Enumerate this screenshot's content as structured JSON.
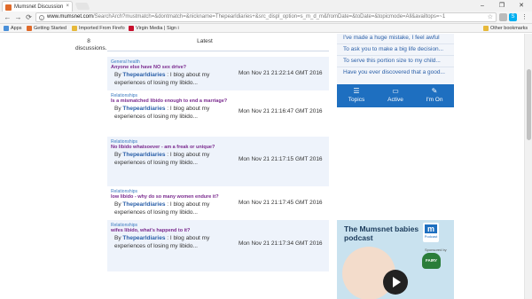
{
  "browser": {
    "tab_title": "Mumsnet Discussion",
    "tab_close": "×",
    "url_host": "www.mumsnet.com",
    "url_rest": "/SearchArch?mustmatch=&dontmatch=&nickname=Thepearldiaries+&src_displ_option=s_m_d_m&fromDate=&toDate=&topicmode=All&availtops=~1",
    "window_controls": [
      "–",
      "❐",
      "✕"
    ]
  },
  "bookmarks": {
    "items": [
      {
        "label": "Apps",
        "color": "#4a90d9"
      },
      {
        "label": "Getting Started",
        "color": "#e06a2a"
      },
      {
        "label": "Imported From Firefo",
        "color": "#e7b93a"
      },
      {
        "label": "Virgin Media | Sign i",
        "color": "#c8102e"
      }
    ],
    "other": "Other bookmarks"
  },
  "table": {
    "discussions": "8 discussions.",
    "latest_header": "Latest",
    "rows": [
      {
        "category": "General health",
        "title": "Anyone else have NO sex drive?",
        "by_prefix": "By ",
        "author": "Thepearldiaries",
        "snippet": " : I blog about my experiences of losing my libido...",
        "date": "Mon Nov 21 21:22:14 GMT 2016"
      },
      {
        "category": "Relationships",
        "title": "Is a mismatched libido enough to end a marriage?",
        "by_prefix": "By ",
        "author": "Thepearldiaries",
        "snippet": " : I blog about my experiences of losing my libido...",
        "date": "Mon Nov 21 21:16:47 GMT 2016"
      },
      {
        "category": "Relationships",
        "title": "No libido whatsoever - am a freak or unique?",
        "by_prefix": "By ",
        "author": "Thepearldiaries",
        "snippet": " : I blog about my experiences of losing my libido...",
        "date": "Mon Nov 21 21:17:15 GMT 2016"
      },
      {
        "category": "Relationships",
        "title": "low libido - why do so many women endure it?",
        "by_prefix": "By ",
        "author": "Thepearldiaries",
        "snippet": " : I blog about my experiences of losing my libido...",
        "date": "Mon Nov 21 21:17:45 GMT 2016"
      },
      {
        "category": "Relationships",
        "title": "wifes libido, what's happend to it?",
        "by_prefix": "By ",
        "author": "Thepearldiaries",
        "snippet": " : I blog about my experiences of losing my libido...",
        "date": "Mon Nov 21 21:17:34 GMT 2016"
      }
    ]
  },
  "sidebar": {
    "links": [
      "I've made a huge mistake, I feel awful",
      "To ask you to make a big life decision...",
      "To serve this portion size to my child...",
      "Have you ever discovered that a good..."
    ],
    "nav": [
      {
        "label": "Topics",
        "icon": "list-icon",
        "glyph": "☰"
      },
      {
        "label": "Active",
        "icon": "chat-icon",
        "glyph": "💬"
      },
      {
        "label": "I'm On",
        "icon": "pin-icon",
        "glyph": "📌"
      }
    ]
  },
  "ad": {
    "headline": "The Mumsnet babies podcast",
    "logo_letter": "m",
    "logo_sub": "Podcast",
    "sponsored": "Sponsored by",
    "sponsor": "FAIRY"
  },
  "colors": {
    "accent": "#1e6fc0",
    "title_purple": "#7a2a8e",
    "link_blue": "#2a5fa8",
    "row_alt": "#eef3fb"
  }
}
